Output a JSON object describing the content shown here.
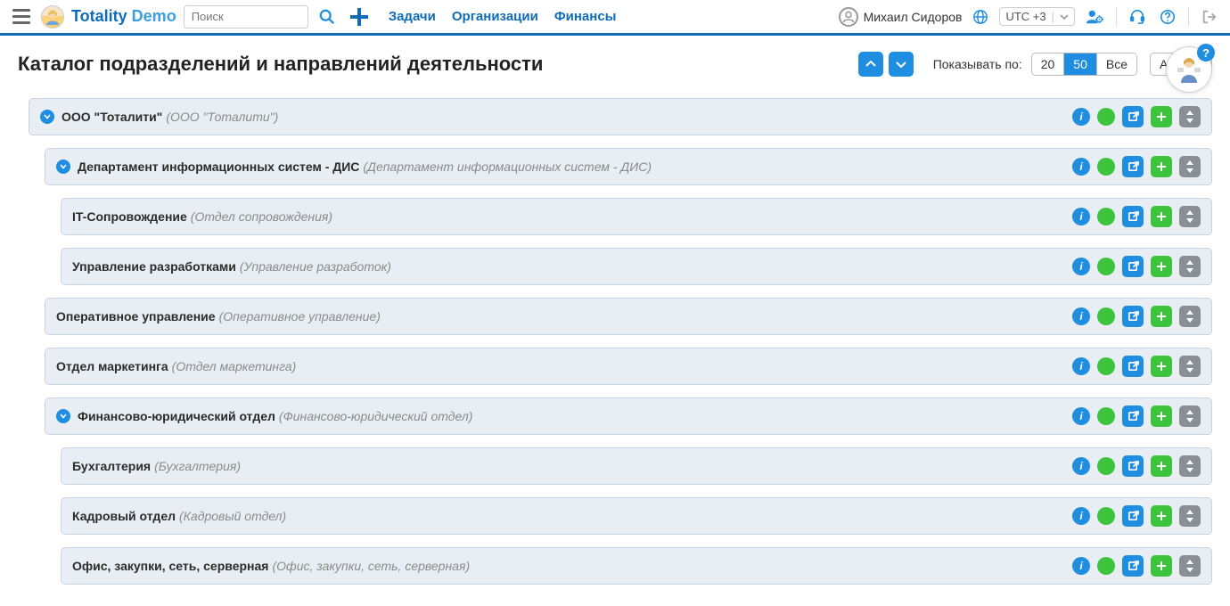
{
  "header": {
    "logo1": "Totality",
    "logo2": " Demo",
    "search_placeholder": "Поиск",
    "nav": {
      "tasks": "Задачи",
      "orgs": "Организации",
      "finance": "Финансы"
    },
    "user_name": "Михаил Сидоров",
    "timezone": "UTC +3"
  },
  "toolbar": {
    "title": "Каталог подразделений и направлений деятельности",
    "show_label": "Показывать по:",
    "seg20": "20",
    "seg50": "50",
    "segAll": "Все",
    "filter": "Активные"
  },
  "rows": [
    {
      "level": 0,
      "expandable": true,
      "title": "ООО \"Тоталити\"",
      "sub": "(ООО \"Тоталити\")"
    },
    {
      "level": 1,
      "expandable": true,
      "title": "Департамент информационных систем - ДИС",
      "sub": "(Департамент информационных систем - ДИС)"
    },
    {
      "level": 2,
      "expandable": false,
      "title": "IT-Сопровождение",
      "sub": "(Отдел сопровождения)"
    },
    {
      "level": 2,
      "expandable": false,
      "title": "Управление разработками",
      "sub": "(Управление разработок)"
    },
    {
      "level": 1,
      "expandable": false,
      "title": "Оперативное управление",
      "sub": "(Оперативное управление)"
    },
    {
      "level": 1,
      "expandable": false,
      "title": "Отдел маркетинга",
      "sub": "(Отдел маркетинга)"
    },
    {
      "level": 1,
      "expandable": true,
      "title": "Финансово-юридический отдел",
      "sub": "(Финансово-юридический отдел)"
    },
    {
      "level": 2,
      "expandable": false,
      "title": "Бухгалтерия",
      "sub": "(Бухгалтерия)"
    },
    {
      "level": 2,
      "expandable": false,
      "title": "Кадровый отдел",
      "sub": "(Кадровый отдел)"
    },
    {
      "level": 2,
      "expandable": false,
      "title": "Офис, закупки, сеть, серверная",
      "sub": "(Офис, закупки, сеть, серверная)"
    }
  ]
}
